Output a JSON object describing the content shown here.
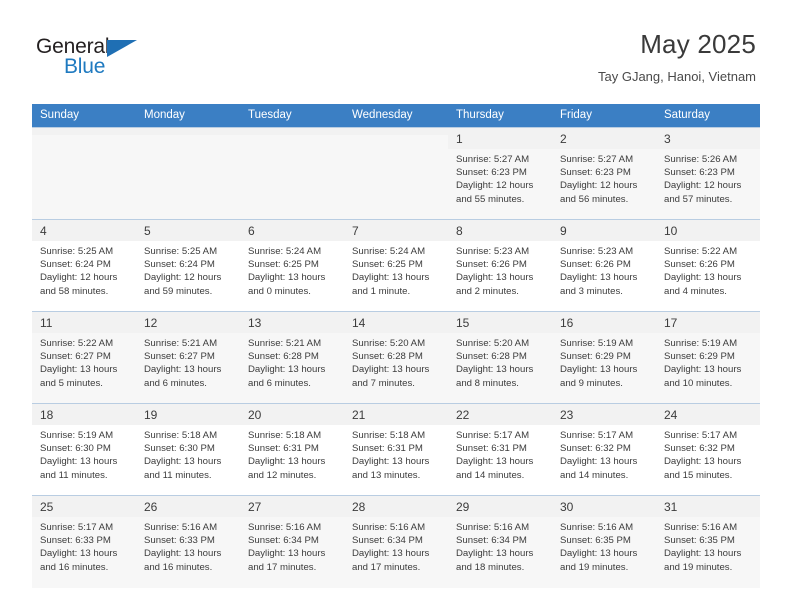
{
  "brand": {
    "name_top": "General",
    "name_bottom": "Blue",
    "triangle_icon": "triangle-icon",
    "accent_color": "#1f7ac0"
  },
  "header": {
    "title": "May 2025",
    "subtitle": "Tay GJang, Hanoi, Vietnam"
  },
  "theme": {
    "header_row_bg": "#3b7fc4",
    "header_row_text": "#ffffff",
    "alt_row_bg": "#f7f7f7",
    "daynum_bg": "#f2f2f2",
    "grid_line": "#b9cde2"
  },
  "weekday_headers": [
    "Sunday",
    "Monday",
    "Tuesday",
    "Wednesday",
    "Thursday",
    "Friday",
    "Saturday"
  ],
  "labels": {
    "sunrise_prefix": "Sunrise:",
    "sunset_prefix": "Sunset:",
    "daylight_prefix": "Daylight:"
  },
  "weeks": [
    [
      {
        "day": "",
        "empty": true
      },
      {
        "day": "",
        "empty": true
      },
      {
        "day": "",
        "empty": true
      },
      {
        "day": "",
        "empty": true
      },
      {
        "day": "1",
        "sunrise": "Sunrise: 5:27 AM",
        "sunset": "Sunset: 6:23 PM",
        "daylight_l1": "Daylight: 12 hours",
        "daylight_l2": "and 55 minutes."
      },
      {
        "day": "2",
        "sunrise": "Sunrise: 5:27 AM",
        "sunset": "Sunset: 6:23 PM",
        "daylight_l1": "Daylight: 12 hours",
        "daylight_l2": "and 56 minutes."
      },
      {
        "day": "3",
        "sunrise": "Sunrise: 5:26 AM",
        "sunset": "Sunset: 6:23 PM",
        "daylight_l1": "Daylight: 12 hours",
        "daylight_l2": "and 57 minutes."
      }
    ],
    [
      {
        "day": "4",
        "sunrise": "Sunrise: 5:25 AM",
        "sunset": "Sunset: 6:24 PM",
        "daylight_l1": "Daylight: 12 hours",
        "daylight_l2": "and 58 minutes."
      },
      {
        "day": "5",
        "sunrise": "Sunrise: 5:25 AM",
        "sunset": "Sunset: 6:24 PM",
        "daylight_l1": "Daylight: 12 hours",
        "daylight_l2": "and 59 minutes."
      },
      {
        "day": "6",
        "sunrise": "Sunrise: 5:24 AM",
        "sunset": "Sunset: 6:25 PM",
        "daylight_l1": "Daylight: 13 hours",
        "daylight_l2": "and 0 minutes."
      },
      {
        "day": "7",
        "sunrise": "Sunrise: 5:24 AM",
        "sunset": "Sunset: 6:25 PM",
        "daylight_l1": "Daylight: 13 hours",
        "daylight_l2": "and 1 minute."
      },
      {
        "day": "8",
        "sunrise": "Sunrise: 5:23 AM",
        "sunset": "Sunset: 6:26 PM",
        "daylight_l1": "Daylight: 13 hours",
        "daylight_l2": "and 2 minutes."
      },
      {
        "day": "9",
        "sunrise": "Sunrise: 5:23 AM",
        "sunset": "Sunset: 6:26 PM",
        "daylight_l1": "Daylight: 13 hours",
        "daylight_l2": "and 3 minutes."
      },
      {
        "day": "10",
        "sunrise": "Sunrise: 5:22 AM",
        "sunset": "Sunset: 6:26 PM",
        "daylight_l1": "Daylight: 13 hours",
        "daylight_l2": "and 4 minutes."
      }
    ],
    [
      {
        "day": "11",
        "sunrise": "Sunrise: 5:22 AM",
        "sunset": "Sunset: 6:27 PM",
        "daylight_l1": "Daylight: 13 hours",
        "daylight_l2": "and 5 minutes."
      },
      {
        "day": "12",
        "sunrise": "Sunrise: 5:21 AM",
        "sunset": "Sunset: 6:27 PM",
        "daylight_l1": "Daylight: 13 hours",
        "daylight_l2": "and 6 minutes."
      },
      {
        "day": "13",
        "sunrise": "Sunrise: 5:21 AM",
        "sunset": "Sunset: 6:28 PM",
        "daylight_l1": "Daylight: 13 hours",
        "daylight_l2": "and 6 minutes."
      },
      {
        "day": "14",
        "sunrise": "Sunrise: 5:20 AM",
        "sunset": "Sunset: 6:28 PM",
        "daylight_l1": "Daylight: 13 hours",
        "daylight_l2": "and 7 minutes."
      },
      {
        "day": "15",
        "sunrise": "Sunrise: 5:20 AM",
        "sunset": "Sunset: 6:28 PM",
        "daylight_l1": "Daylight: 13 hours",
        "daylight_l2": "and 8 minutes."
      },
      {
        "day": "16",
        "sunrise": "Sunrise: 5:19 AM",
        "sunset": "Sunset: 6:29 PM",
        "daylight_l1": "Daylight: 13 hours",
        "daylight_l2": "and 9 minutes."
      },
      {
        "day": "17",
        "sunrise": "Sunrise: 5:19 AM",
        "sunset": "Sunset: 6:29 PM",
        "daylight_l1": "Daylight: 13 hours",
        "daylight_l2": "and 10 minutes."
      }
    ],
    [
      {
        "day": "18",
        "sunrise": "Sunrise: 5:19 AM",
        "sunset": "Sunset: 6:30 PM",
        "daylight_l1": "Daylight: 13 hours",
        "daylight_l2": "and 11 minutes."
      },
      {
        "day": "19",
        "sunrise": "Sunrise: 5:18 AM",
        "sunset": "Sunset: 6:30 PM",
        "daylight_l1": "Daylight: 13 hours",
        "daylight_l2": "and 11 minutes."
      },
      {
        "day": "20",
        "sunrise": "Sunrise: 5:18 AM",
        "sunset": "Sunset: 6:31 PM",
        "daylight_l1": "Daylight: 13 hours",
        "daylight_l2": "and 12 minutes."
      },
      {
        "day": "21",
        "sunrise": "Sunrise: 5:18 AM",
        "sunset": "Sunset: 6:31 PM",
        "daylight_l1": "Daylight: 13 hours",
        "daylight_l2": "and 13 minutes."
      },
      {
        "day": "22",
        "sunrise": "Sunrise: 5:17 AM",
        "sunset": "Sunset: 6:31 PM",
        "daylight_l1": "Daylight: 13 hours",
        "daylight_l2": "and 14 minutes."
      },
      {
        "day": "23",
        "sunrise": "Sunrise: 5:17 AM",
        "sunset": "Sunset: 6:32 PM",
        "daylight_l1": "Daylight: 13 hours",
        "daylight_l2": "and 14 minutes."
      },
      {
        "day": "24",
        "sunrise": "Sunrise: 5:17 AM",
        "sunset": "Sunset: 6:32 PM",
        "daylight_l1": "Daylight: 13 hours",
        "daylight_l2": "and 15 minutes."
      }
    ],
    [
      {
        "day": "25",
        "sunrise": "Sunrise: 5:17 AM",
        "sunset": "Sunset: 6:33 PM",
        "daylight_l1": "Daylight: 13 hours",
        "daylight_l2": "and 16 minutes."
      },
      {
        "day": "26",
        "sunrise": "Sunrise: 5:16 AM",
        "sunset": "Sunset: 6:33 PM",
        "daylight_l1": "Daylight: 13 hours",
        "daylight_l2": "and 16 minutes."
      },
      {
        "day": "27",
        "sunrise": "Sunrise: 5:16 AM",
        "sunset": "Sunset: 6:34 PM",
        "daylight_l1": "Daylight: 13 hours",
        "daylight_l2": "and 17 minutes."
      },
      {
        "day": "28",
        "sunrise": "Sunrise: 5:16 AM",
        "sunset": "Sunset: 6:34 PM",
        "daylight_l1": "Daylight: 13 hours",
        "daylight_l2": "and 17 minutes."
      },
      {
        "day": "29",
        "sunrise": "Sunrise: 5:16 AM",
        "sunset": "Sunset: 6:34 PM",
        "daylight_l1": "Daylight: 13 hours",
        "daylight_l2": "and 18 minutes."
      },
      {
        "day": "30",
        "sunrise": "Sunrise: 5:16 AM",
        "sunset": "Sunset: 6:35 PM",
        "daylight_l1": "Daylight: 13 hours",
        "daylight_l2": "and 19 minutes."
      },
      {
        "day": "31",
        "sunrise": "Sunrise: 5:16 AM",
        "sunset": "Sunset: 6:35 PM",
        "daylight_l1": "Daylight: 13 hours",
        "daylight_l2": "and 19 minutes."
      }
    ]
  ]
}
